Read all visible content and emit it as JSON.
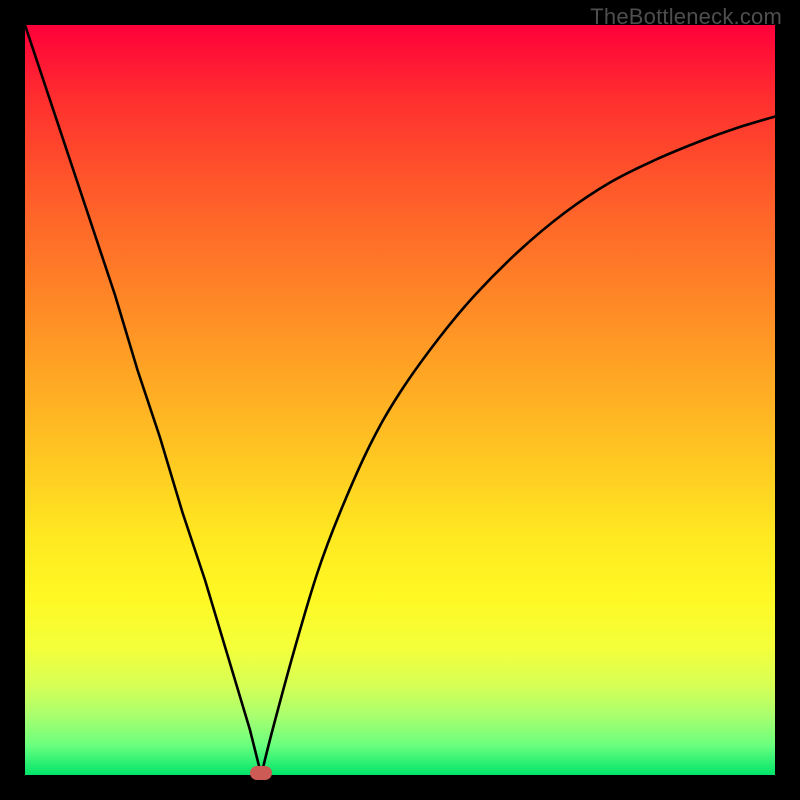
{
  "meta": {
    "watermark": "TheBottleneck.com"
  },
  "colors": {
    "frame": "#000000",
    "curve": "#000000",
    "dot": "#cc5a55",
    "gradient_stops": [
      "#ff003a",
      "#ff2f2f",
      "#ff5a2a",
      "#ff7f27",
      "#ffa424",
      "#ffc822",
      "#ffe821",
      "#fff823",
      "#f4ff3a",
      "#d7ff55",
      "#aaff6e",
      "#6bff7e",
      "#00e56a"
    ]
  },
  "chart_data": {
    "type": "line",
    "title": "",
    "xlabel": "",
    "ylabel": "",
    "xlim": [
      0,
      100
    ],
    "ylim": [
      0,
      100
    ],
    "x": [
      0,
      3,
      6,
      9,
      12,
      15,
      18,
      21,
      24,
      27,
      30,
      31.5,
      33,
      36,
      39,
      42,
      46,
      50,
      55,
      60,
      66,
      72,
      78,
      84,
      90,
      95,
      100
    ],
    "values": [
      100,
      91,
      82,
      73,
      64,
      54,
      45,
      35,
      26,
      16,
      6,
      0,
      6,
      17,
      27,
      35,
      44,
      51,
      58,
      64,
      70,
      75,
      79,
      82,
      84.5,
      86.3,
      87.8
    ],
    "minimum_point": {
      "x": 31.5,
      "y": 0
    }
  }
}
